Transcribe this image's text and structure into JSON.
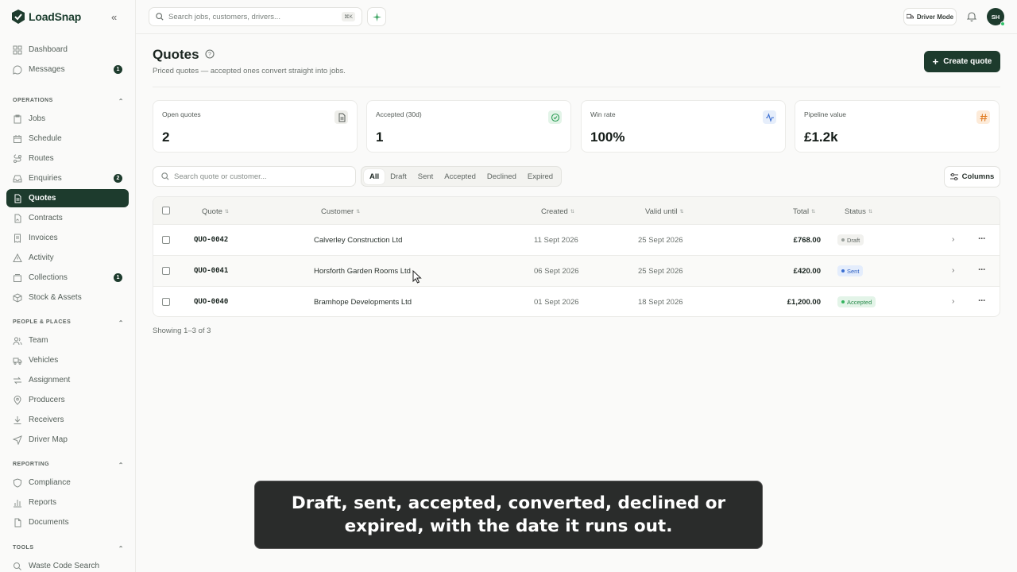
{
  "app": {
    "name": "LoadSnap"
  },
  "sidebar": {
    "top_items": [
      {
        "label": "Dashboard",
        "icon": "grid-icon",
        "badge": null
      },
      {
        "label": "Messages",
        "icon": "chat-icon",
        "badge": "1"
      }
    ],
    "sections": [
      {
        "title": "OPERATIONS",
        "items": [
          {
            "label": "Jobs",
            "icon": "clipboard-icon",
            "badge": null
          },
          {
            "label": "Schedule",
            "icon": "calendar-icon",
            "badge": null
          },
          {
            "label": "Routes",
            "icon": "route-icon",
            "badge": null
          },
          {
            "label": "Enquiries",
            "icon": "inbox-icon",
            "badge": "2"
          },
          {
            "label": "Quotes",
            "icon": "document-icon",
            "badge": null,
            "active": true
          },
          {
            "label": "Contracts",
            "icon": "contract-icon",
            "badge": null
          },
          {
            "label": "Invoices",
            "icon": "receipt-icon",
            "badge": null
          },
          {
            "label": "Activity",
            "icon": "warning-icon",
            "badge": null
          },
          {
            "label": "Collections",
            "icon": "collection-icon",
            "badge": "1"
          },
          {
            "label": "Stock & Assets",
            "icon": "box-icon",
            "badge": null
          }
        ]
      },
      {
        "title": "PEOPLE & PLACES",
        "items": [
          {
            "label": "Team",
            "icon": "users-icon",
            "badge": null
          },
          {
            "label": "Vehicles",
            "icon": "truck-icon",
            "badge": null
          },
          {
            "label": "Assignment",
            "icon": "assign-icon",
            "badge": null
          },
          {
            "label": "Producers",
            "icon": "pin-icon",
            "badge": null
          },
          {
            "label": "Receivers",
            "icon": "download-icon",
            "badge": null
          },
          {
            "label": "Driver Map",
            "icon": "navigation-icon",
            "badge": null
          }
        ]
      },
      {
        "title": "REPORTING",
        "items": [
          {
            "label": "Compliance",
            "icon": "shield-icon",
            "badge": null
          },
          {
            "label": "Reports",
            "icon": "bar-chart-icon",
            "badge": null
          },
          {
            "label": "Documents",
            "icon": "file-icon",
            "badge": null
          }
        ]
      },
      {
        "title": "TOOLS",
        "items": [
          {
            "label": "Waste Code Search",
            "icon": "search-icon",
            "badge": null
          }
        ]
      }
    ]
  },
  "topbar": {
    "search_placeholder": "Search jobs, customers, drivers...",
    "shortcut": "⌘K",
    "driver_mode": "Driver Mode",
    "avatar_initials": "SH"
  },
  "header": {
    "title": "Quotes",
    "subtitle": "Priced quotes — accepted ones convert straight into jobs.",
    "create_label": "Create quote"
  },
  "stats": [
    {
      "label": "Open quotes",
      "value": "2",
      "icon": "document-icon",
      "icon_bg": "#eeeeea",
      "icon_color": "#555c58"
    },
    {
      "label": "Accepted (30d)",
      "value": "1",
      "icon": "check-circle-icon",
      "icon_bg": "#e3f4e8",
      "icon_color": "#2f9e57"
    },
    {
      "label": "Win rate",
      "value": "100%",
      "icon": "activity-icon",
      "icon_bg": "#e6eefb",
      "icon_color": "#3b6fd1"
    },
    {
      "label": "Pipeline value",
      "value": "£1.2k",
      "icon": "hash-icon",
      "icon_bg": "#fdebd9",
      "icon_color": "#e07a1f"
    }
  ],
  "filters": {
    "search_placeholder": "Search quote or customer...",
    "tabs": [
      "All",
      "Draft",
      "Sent",
      "Accepted",
      "Declined",
      "Expired"
    ],
    "active_tab": "All",
    "columns_label": "Columns"
  },
  "table": {
    "headers": [
      "Quote",
      "Customer",
      "Created",
      "Valid until",
      "Total",
      "Status"
    ],
    "rows": [
      {
        "quote": "QUO-0042",
        "customer": "Calverley Construction Ltd",
        "created": "11 Sept 2026",
        "valid_until": "25 Sept 2026",
        "total": "£768.00",
        "status": "Draft",
        "status_bg": "#f1f1ee",
        "status_color": "#5c635f",
        "dot": "#9aa09c"
      },
      {
        "quote": "QUO-0041",
        "customer": "Horsforth Garden Rooms Ltd",
        "created": "06 Sept 2026",
        "valid_until": "25 Sept 2026",
        "total": "£420.00",
        "status": "Sent",
        "status_bg": "#e4edfc",
        "status_color": "#2d5fc2",
        "dot": "#3b6fd1"
      },
      {
        "quote": "QUO-0040",
        "customer": "Bramhope Developments Ltd",
        "created": "01 Sept 2026",
        "valid_until": "18 Sept 2026",
        "total": "£1,200.00",
        "status": "Accepted",
        "status_bg": "#e3f4e8",
        "status_color": "#2a8a4c",
        "dot": "#33b35e"
      }
    ],
    "footer": "Showing 1–3 of 3"
  },
  "caption": "Draft, sent, accepted, converted, declined or expired, with the date it runs out."
}
